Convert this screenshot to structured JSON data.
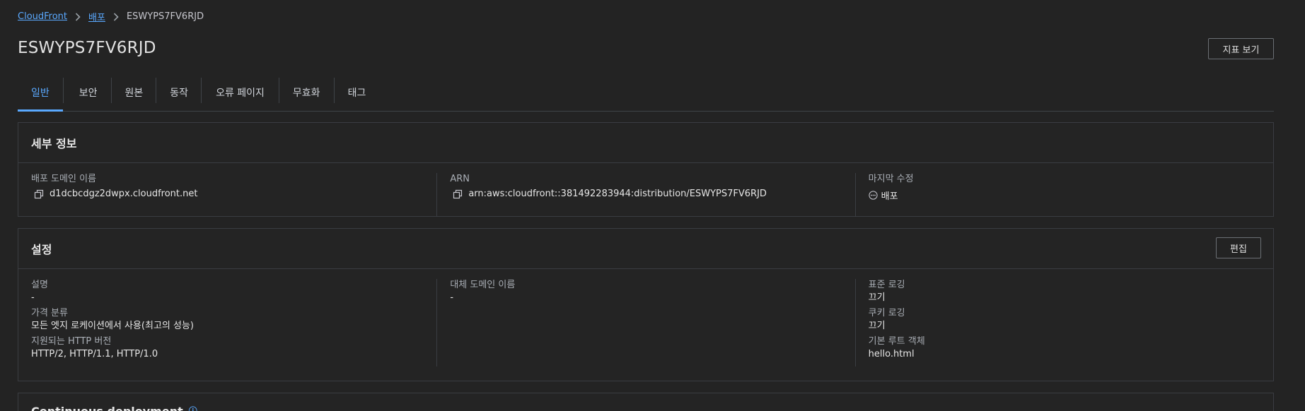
{
  "breadcrumb": {
    "items": [
      "CloudFront",
      "배포"
    ],
    "current": "ESWYPS7FV6RJD"
  },
  "page": {
    "title": "ESWYPS7FV6RJD",
    "view_metrics_label": "지표 보기"
  },
  "tabs": [
    {
      "label": "일반",
      "active": true
    },
    {
      "label": "보안"
    },
    {
      "label": "원본"
    },
    {
      "label": "동작"
    },
    {
      "label": "오류 페이지"
    },
    {
      "label": "무효화"
    },
    {
      "label": "태그"
    }
  ],
  "details": {
    "title": "세부 정보",
    "domain_label": "배포 도메인 이름",
    "domain_value": "d1dcbcdgz2dwpx.cloudfront.net",
    "arn_label": "ARN",
    "arn_value": "arn:aws:cloudfront::381492283944:distribution/ESWYPS7FV6RJD",
    "modified_label": "마지막 수정",
    "modified_value": "배포"
  },
  "settings": {
    "title": "설정",
    "edit_label": "편집",
    "description_label": "설명",
    "description_value": "-",
    "price_class_label": "가격 분류",
    "price_class_value": "모든 엣지 로케이션에서 사용(최고의 성능)",
    "http_label": "지원되는 HTTP 버전",
    "http_value": "HTTP/2, HTTP/1.1, HTTP/1.0",
    "alt_domain_label": "대체 도메인 이름",
    "alt_domain_value": "-",
    "std_logging_label": "표준 로깅",
    "std_logging_value": "끄기",
    "cookie_logging_label": "쿠키 로깅",
    "cookie_logging_value": "끄기",
    "root_object_label": "기본 루트 객체",
    "root_object_value": "hello.html"
  },
  "continuous_deployment": {
    "title": "Continuous deployment"
  },
  "colors": {
    "background": "#232323",
    "link": "#5aa9ff",
    "border": "#3a3d42",
    "text": "#e6e6e6",
    "label": "#a9aeb5"
  },
  "icons": [
    "chevron-right-icon",
    "copy-icon",
    "in-progress-icon",
    "info-icon"
  ]
}
